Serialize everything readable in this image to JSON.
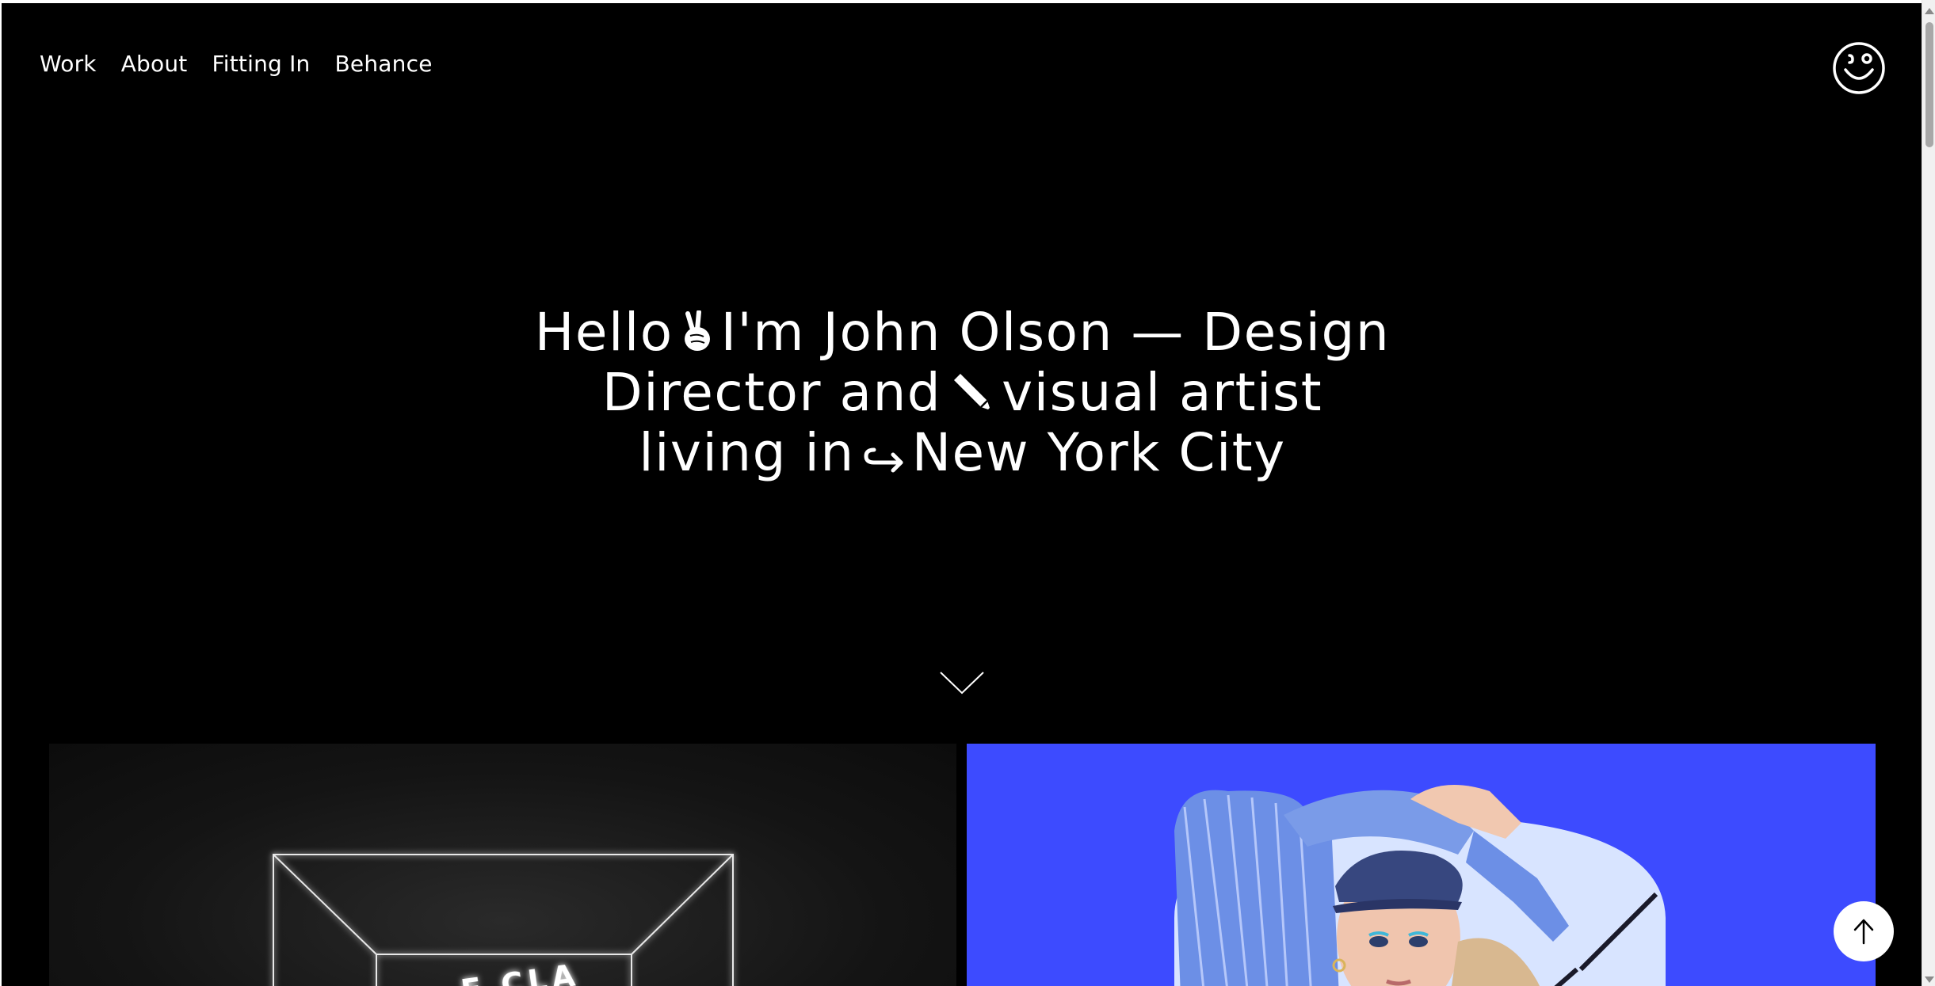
{
  "nav": {
    "items": [
      {
        "label": "Work"
      },
      {
        "label": "About"
      },
      {
        "label": "Fitting In"
      },
      {
        "label": "Behance"
      }
    ]
  },
  "logo": {
    "icon": "smiley-face-icon"
  },
  "hero": {
    "line1_a": "Hello",
    "line1_icon": "peace-hand-icon",
    "line1_b": "I'm John Olson — Design",
    "line2_a": "Director and",
    "line2_icon": "pencil-icon",
    "line2_b": "visual artist",
    "line3_a": "living in",
    "line3_icon": "arrow-hook-icon",
    "line3_b": "New York City"
  },
  "scroll_hint": {
    "icon": "chevron-down-icon"
  },
  "projects": [
    {
      "name": "neon-box-project",
      "partial_text": "E CLA",
      "background": "#141414"
    },
    {
      "name": "fashion-portrait-project",
      "background": "#3d4bff"
    }
  ],
  "back_to_top": {
    "icon": "arrow-up-icon"
  },
  "colors": {
    "background": "#000000",
    "text": "#ffffff",
    "accent_blue": "#3d4bff"
  }
}
